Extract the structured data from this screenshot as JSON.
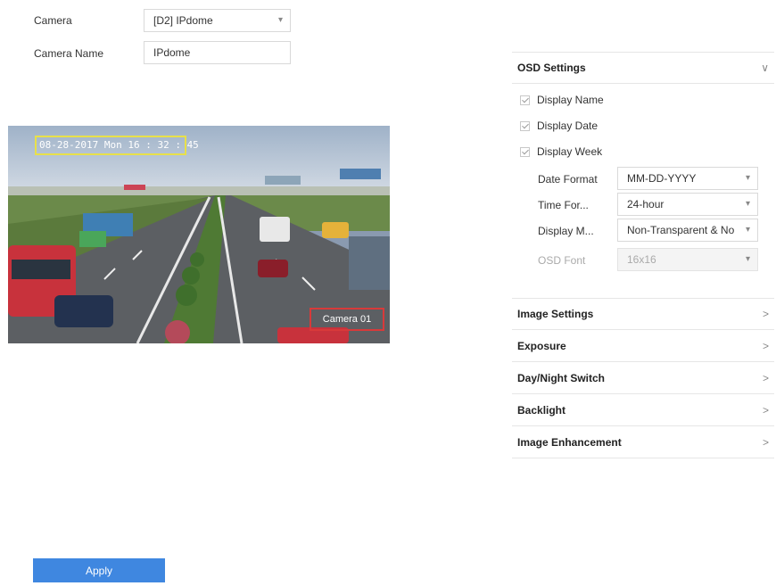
{
  "camera": {
    "label": "Camera",
    "value": "[D2] IPdome"
  },
  "camera_name": {
    "label": "Camera Name",
    "value": "IPdome"
  },
  "preview": {
    "osd_date_text": "08-28-2017 Mon 16 : 32 : 45",
    "osd_name_text": "Camera 01"
  },
  "osd_settings": {
    "title": "OSD Settings",
    "checkboxes": [
      "Display Name",
      "Display Date",
      "Display Week"
    ],
    "date_format": {
      "label": "Date Format",
      "value": "MM-DD-YYYY"
    },
    "time_format": {
      "label": "Time For...",
      "value": "24-hour"
    },
    "display_mode": {
      "label": "Display M...",
      "value": "Non-Transparent & No"
    },
    "osd_font": {
      "label": "OSD Font",
      "value": "16x16"
    }
  },
  "sections": [
    "Image Settings",
    "Exposure",
    "Day/Night Switch",
    "Backlight",
    "Image Enhancement"
  ],
  "apply_label": "Apply",
  "colors": {
    "accent": "#3f87e0",
    "osd_date_border": "#e8e04a",
    "osd_name_border": "#d83a3a"
  }
}
